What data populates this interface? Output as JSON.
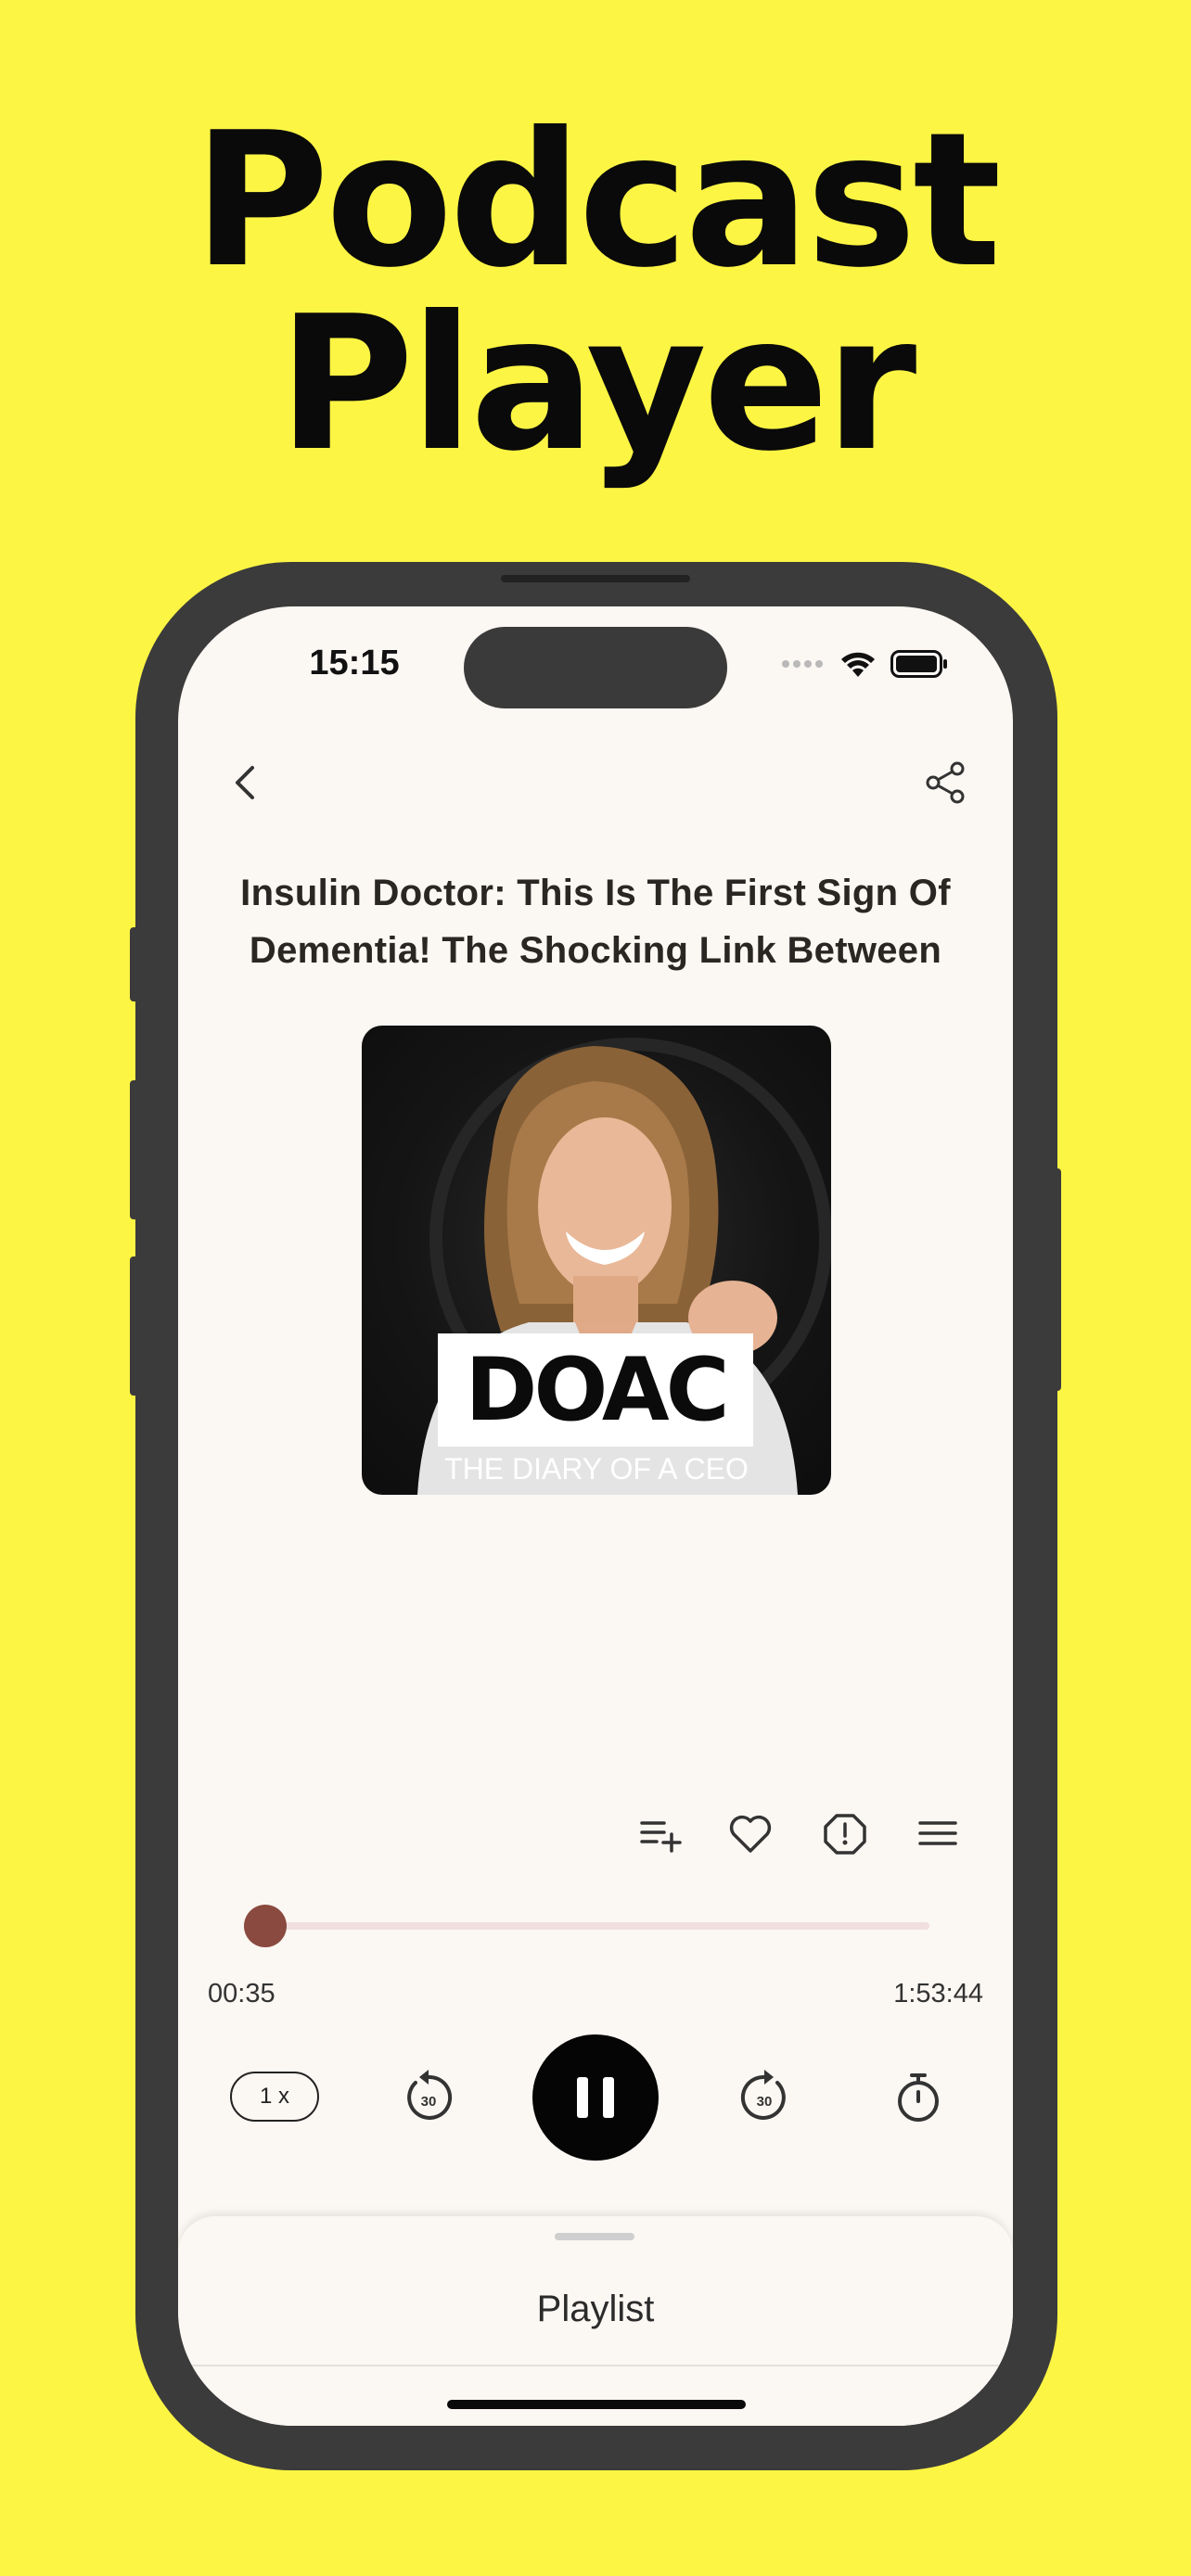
{
  "promo": {
    "line1": "Podcast",
    "line2": "Player"
  },
  "status_bar": {
    "time": "15:15",
    "icons": [
      "signal-dots-icon",
      "wifi-icon",
      "battery-icon"
    ]
  },
  "nav": {
    "back_icon": "chevron-left-icon",
    "share_icon": "share-icon"
  },
  "episode": {
    "title": "Insulin Doctor: This Is The First Sign Of Dementia! The Shocking Link Between",
    "artwork": {
      "logo_text": "DOAC",
      "caption": "THE DIARY OF A CEO"
    }
  },
  "actions": {
    "icons": [
      "add-to-queue-icon",
      "heart-icon",
      "report-icon",
      "menu-icon"
    ]
  },
  "progress": {
    "elapsed": "00:35",
    "duration": "1:53:44",
    "fraction": 0.005
  },
  "controls": {
    "speed_label": "1 x",
    "rewind_label": "30",
    "forward_label": "30",
    "state": "playing"
  },
  "sheet": {
    "title": "Playlist"
  },
  "colors": {
    "background": "#fdf544",
    "screen": "#fbf7f3",
    "accent": "#8a4a3f",
    "track": "#f1dfe0"
  }
}
